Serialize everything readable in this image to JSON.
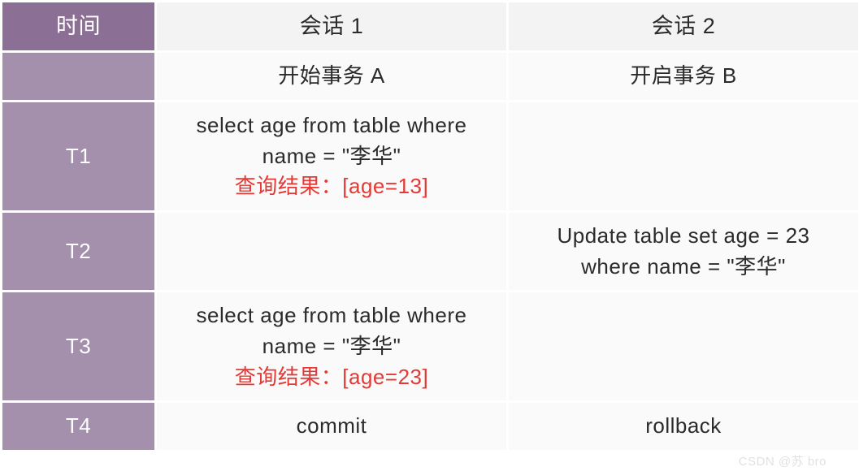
{
  "headers": {
    "time": "时间",
    "session1": "会话 1",
    "session2": "会话 2"
  },
  "rows": [
    {
      "time": "",
      "s1": {
        "lines": [
          "开始事务 A"
        ]
      },
      "s2": {
        "lines": [
          "开启事务 B"
        ]
      }
    },
    {
      "time": "T1",
      "s1": {
        "lines": [
          "select age from table where",
          "name =  \"李华\""
        ],
        "result": "查询结果：[age=13]"
      },
      "s2": {
        "lines": []
      }
    },
    {
      "time": "T2",
      "s1": {
        "lines": []
      },
      "s2": {
        "lines": [
          "Update table set age = 23",
          "where name =  \"李华\""
        ]
      }
    },
    {
      "time": "T3",
      "s1": {
        "lines": [
          "select age from table where",
          "name =  \"李华\""
        ],
        "result": "查询结果：[age=23]"
      },
      "s2": {
        "lines": []
      }
    },
    {
      "time": "T4",
      "s1": {
        "lines": [
          "commit"
        ]
      },
      "s2": {
        "lines": [
          "rollback"
        ]
      }
    }
  ],
  "watermark": "CSDN @苏 bro"
}
